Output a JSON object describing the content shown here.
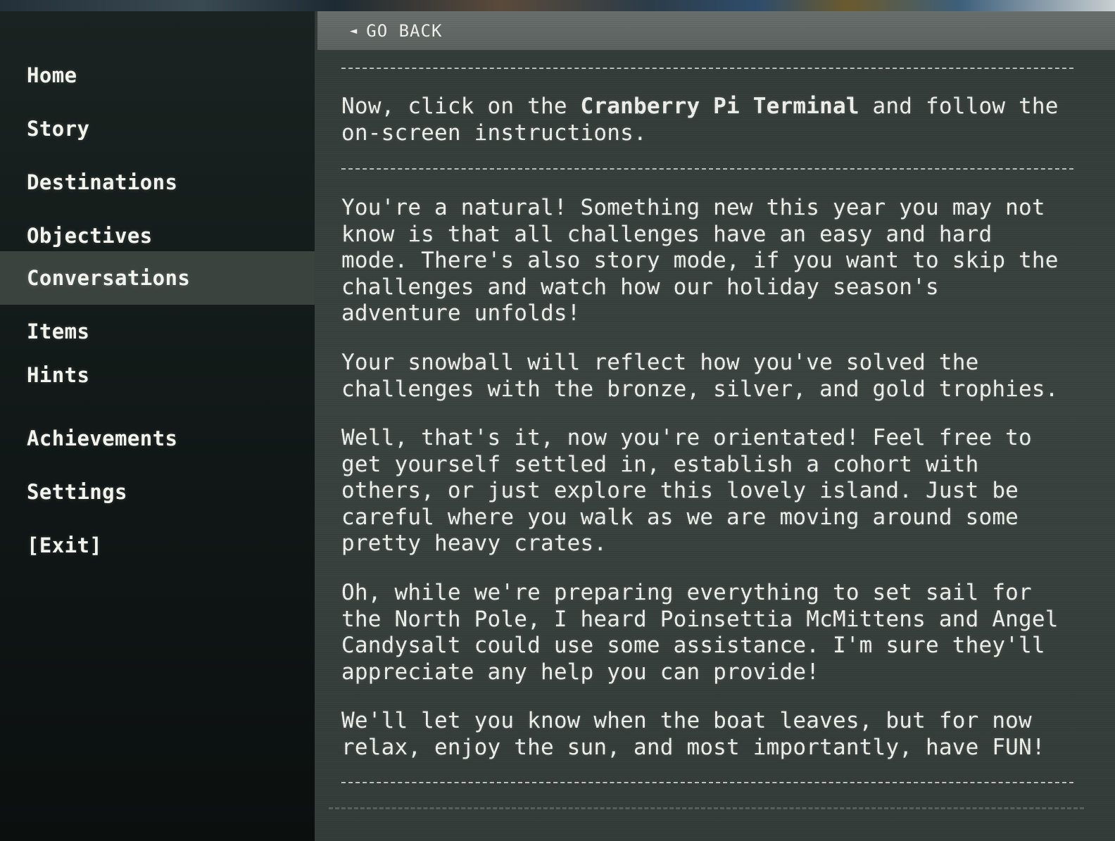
{
  "sidebar": {
    "items": [
      {
        "label": "Home",
        "active": false
      },
      {
        "label": "Story",
        "active": false
      },
      {
        "label": "Destinations",
        "active": false
      },
      {
        "label": "Objectives",
        "active": false
      },
      {
        "label": "Conversations",
        "active": true
      },
      {
        "label": "Items",
        "active": false
      },
      {
        "label": "Hints",
        "active": false
      },
      {
        "label": "Achievements",
        "active": false
      },
      {
        "label": "Settings",
        "active": false
      },
      {
        "label": "[Exit]",
        "active": false
      }
    ]
  },
  "header": {
    "back_icon": "◄",
    "back_label": "GO BACK"
  },
  "conversation": {
    "intro_pre": "Now, click on the ",
    "intro_bold": "Cranberry Pi Terminal",
    "intro_post": " and follow the\non-screen instructions.",
    "paragraphs": [
      "You're a natural! Something new this year you may not\nknow is that all challenges have an easy and hard\nmode. There's also story mode, if you want to skip the\nchallenges and watch how our holiday season's\nadventure unfolds!",
      "Your snowball will reflect how you've solved the\nchallenges with the bronze, silver, and gold trophies.",
      "Well, that's it, now you're orientated! Feel free to\nget yourself settled in, establish a cohort with\nothers, or just explore this lovely island. Just be\ncareful where you walk as we are moving around some\npretty heavy crates.",
      "Oh, while we're preparing everything to set sail for\nthe North Pole, I heard Poinsettia McMittens and Angel\nCandysalt could use some assistance. I'm sure they'll\nappreciate any help you can provide!",
      "We'll let you know when the boat leaves, but for now\nrelax, enjoy the sun, and most importantly, have FUN!"
    ]
  },
  "colors": {
    "sidebar_bg": "#121918",
    "active_item_bg": "#3b433f",
    "main_bg": "#394240",
    "header_bar_bg": "#646a67",
    "text": "#f0f1ec"
  }
}
